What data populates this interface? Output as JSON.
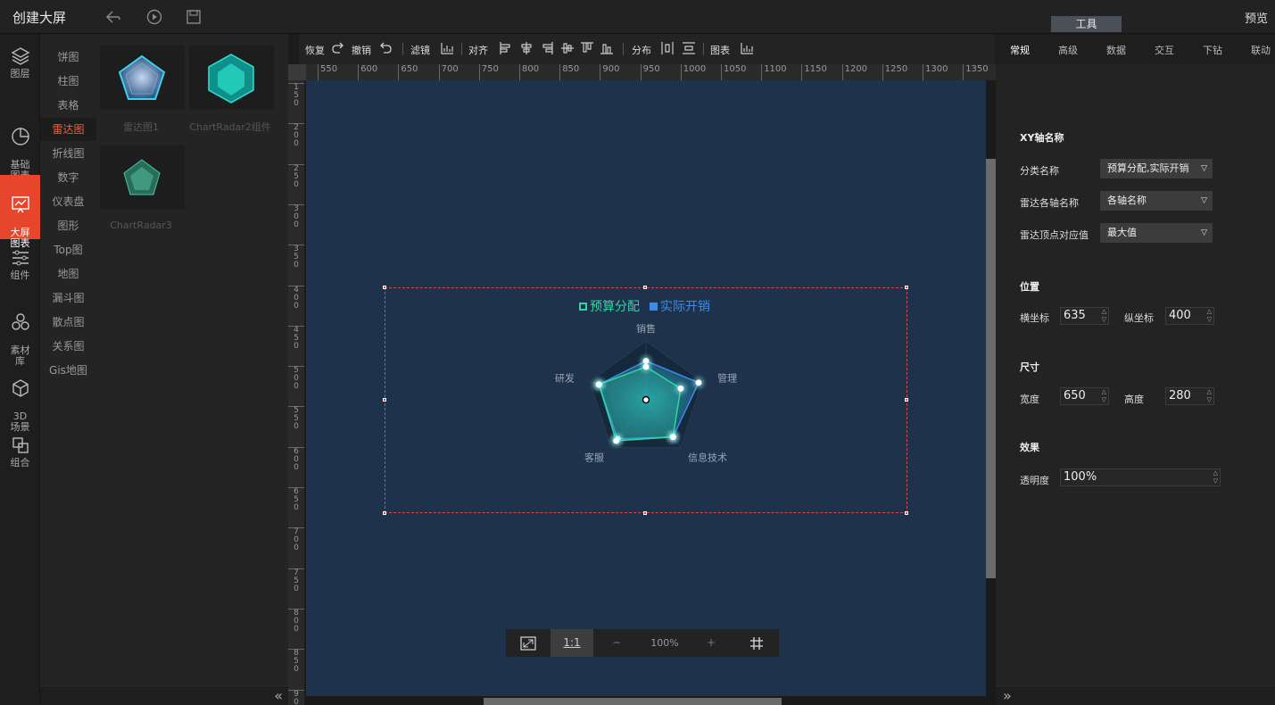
{
  "app": {
    "title": "创建大屏",
    "preview": "预览",
    "tools_tab": "工具"
  },
  "leftbar": [
    {
      "label": "图层",
      "icon": "layers-icon"
    },
    {
      "label": "基础\n图表",
      "icon": "pie-icon"
    },
    {
      "label": "大屏\n图表",
      "icon": "bigscreen-chart-icon",
      "active": true
    },
    {
      "label": "组件",
      "icon": "sliders-icon"
    },
    {
      "label": "素材\n库",
      "icon": "material-icon"
    },
    {
      "label": "3D\n场景",
      "icon": "cube-icon"
    },
    {
      "label": "组合",
      "icon": "group-icon"
    }
  ],
  "categories": [
    "饼图",
    "柱图",
    "表格",
    "雷达图",
    "折线图",
    "数字",
    "仪表盘",
    "图形",
    "Top图",
    "地图",
    "漏斗图",
    "散点图",
    "关系图",
    "Gis地图"
  ],
  "active_category": "雷达图",
  "thumbs": [
    "雷达图1",
    "ChartRadar2组件",
    "ChartRadar3"
  ],
  "toolbar": {
    "redo": "恢复",
    "undo": "撤销",
    "filter": "滤镜",
    "align": "对齐",
    "distribute": "分布",
    "chart": "图表"
  },
  "ruler_h": [
    "550",
    "600",
    "650",
    "700",
    "750",
    "800",
    "850",
    "900",
    "950",
    "1000",
    "1050",
    "1100",
    "1150",
    "1200",
    "1250",
    "1300",
    "1350"
  ],
  "ruler_v": [
    "150",
    "200",
    "250",
    "300",
    "350",
    "400",
    "450",
    "500",
    "550",
    "600",
    "650",
    "700",
    "750",
    "800",
    "850",
    "900"
  ],
  "chart": {
    "legend": [
      {
        "name": "预算分配",
        "color": "#2fd6a0"
      },
      {
        "name": "实际开销",
        "color": "#3b8bea"
      }
    ],
    "axes": [
      "销售",
      "管理",
      "信息技术",
      "客服",
      "研发"
    ],
    "series": [
      {
        "name": "预算分配",
        "values": [
          0.56,
          0.62,
          0.78,
          0.86,
          0.84
        ],
        "color": "#2fd6a0"
      },
      {
        "name": "实际开销",
        "values": [
          0.66,
          0.94,
          0.78,
          0.82,
          0.84
        ],
        "color": "#3b8bea"
      }
    ]
  },
  "zoom": {
    "fit": "⛶",
    "one_to_one": "1:1",
    "minus": "−",
    "level": "100%",
    "plus": "+",
    "grid": "#"
  },
  "panel": {
    "tabs": [
      "常规",
      "高级",
      "数据",
      "交互",
      "下钻",
      "联动"
    ],
    "xy_section": "XY轴名称",
    "category_name_label": "分类名称",
    "category_name_value": "预算分配,实际开销",
    "axis_name_label": "雷达各轴名称",
    "axis_name_value": "各轴名称",
    "vertex_label": "雷达顶点对应值",
    "vertex_value": "最大值",
    "position_section": "位置",
    "x_label": "横坐标",
    "x_value": "635",
    "y_label": "纵坐标",
    "y_value": "400",
    "size_section": "尺寸",
    "w_label": "宽度",
    "w_value": "650",
    "h_label": "高度",
    "h_value": "280",
    "effect_section": "效果",
    "opacity_label": "透明度",
    "opacity_value": "100%"
  }
}
